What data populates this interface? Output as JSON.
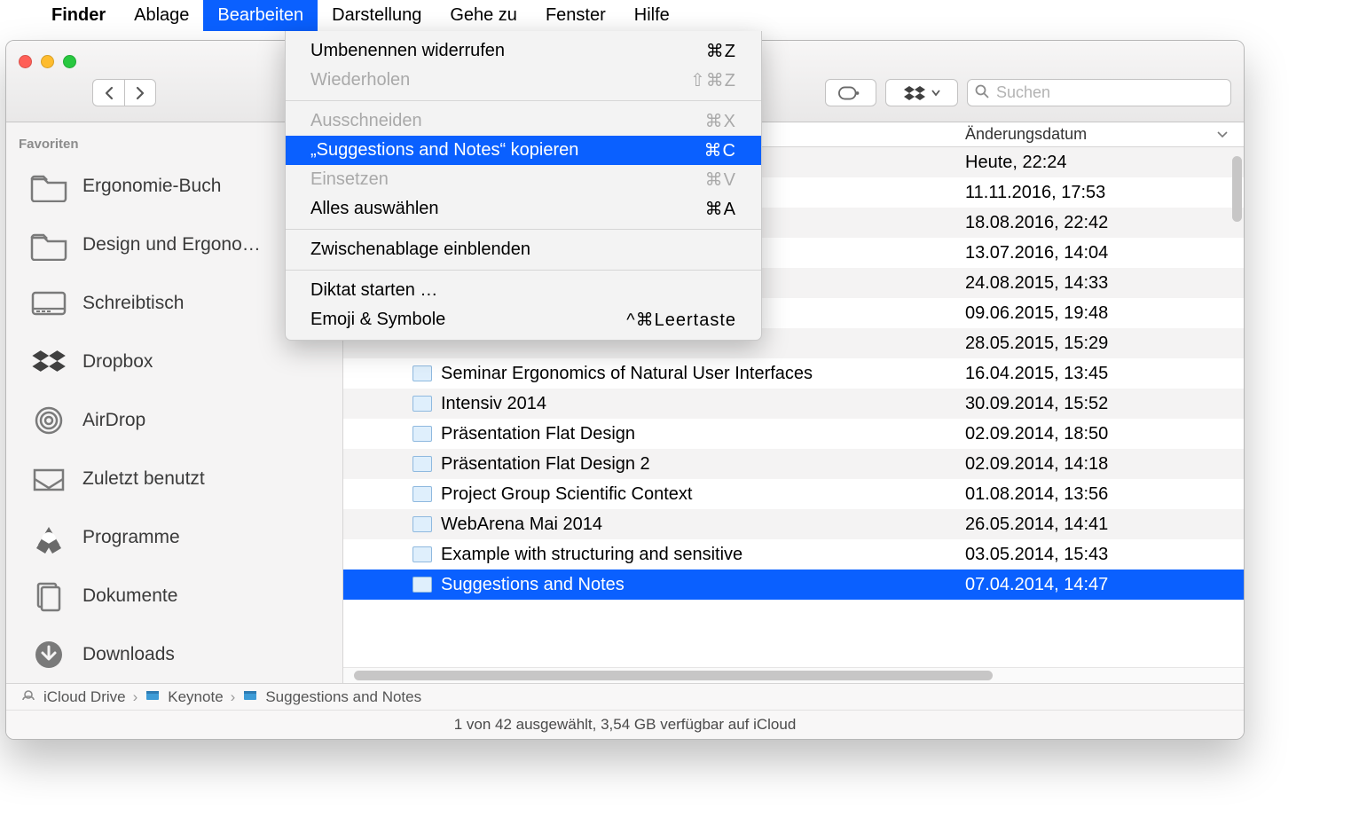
{
  "menubar": {
    "app": "Finder",
    "items": [
      "Ablage",
      "Bearbeiten",
      "Darstellung",
      "Gehe zu",
      "Fenster",
      "Hilfe"
    ],
    "active_index": 1
  },
  "dropdown": {
    "items": [
      {
        "label": "Umbenennen widerrufen",
        "shortcut": "⌘Z",
        "disabled": false
      },
      {
        "label": "Wiederholen",
        "shortcut": "⇧⌘Z",
        "disabled": true
      },
      {
        "sep": true
      },
      {
        "label": "Ausschneiden",
        "shortcut": "⌘X",
        "disabled": true
      },
      {
        "label": "„Suggestions and Notes“ kopieren",
        "shortcut": "⌘C",
        "hl": true
      },
      {
        "label": "Einsetzen",
        "shortcut": "⌘V",
        "disabled": true
      },
      {
        "label": "Alles auswählen",
        "shortcut": "⌘A"
      },
      {
        "sep": true
      },
      {
        "label": "Zwischenablage einblenden",
        "shortcut": ""
      },
      {
        "sep": true
      },
      {
        "label": "Diktat starten …",
        "shortcut": ""
      },
      {
        "label": "Emoji & Symbole",
        "shortcut": "^⌘Leertaste"
      }
    ]
  },
  "toolbar": {
    "search_placeholder": "Suchen"
  },
  "sidebar": {
    "header": "Favoriten",
    "items": [
      {
        "icon": "folder",
        "label": "Ergonomie-Buch"
      },
      {
        "icon": "folder",
        "label": "Design und Ergono…"
      },
      {
        "icon": "desktop",
        "label": "Schreibtisch"
      },
      {
        "icon": "dropbox",
        "label": "Dropbox"
      },
      {
        "icon": "airdrop",
        "label": "AirDrop"
      },
      {
        "icon": "recent",
        "label": "Zuletzt benutzt"
      },
      {
        "icon": "apps",
        "label": "Programme"
      },
      {
        "icon": "docs",
        "label": "Dokumente"
      },
      {
        "icon": "downloads",
        "label": "Downloads"
      }
    ]
  },
  "columns": {
    "name": "",
    "date": "Änderungsdatum"
  },
  "files": [
    {
      "name": "",
      "date": "Heute, 22:24"
    },
    {
      "name": "",
      "date": "11.11.2016, 17:53"
    },
    {
      "name": "",
      "date": "18.08.2016, 22:42"
    },
    {
      "name": "",
      "date": "13.07.2016, 14:04"
    },
    {
      "name": "",
      "date": "24.08.2015, 14:33"
    },
    {
      "name": "",
      "date": "09.06.2015, 19:48"
    },
    {
      "name": "",
      "date": "28.05.2015, 15:29"
    },
    {
      "name": "Seminar Ergonomics of Natural User Interfaces",
      "date": "16.04.2015, 13:45"
    },
    {
      "name": "Intensiv 2014",
      "date": "30.09.2014, 15:52"
    },
    {
      "name": "Präsentation Flat Design",
      "date": "02.09.2014, 18:50"
    },
    {
      "name": "Präsentation Flat Design 2",
      "date": "02.09.2014, 14:18"
    },
    {
      "name": "Project Group Scientific Context",
      "date": "01.08.2014, 13:56"
    },
    {
      "name": "WebArena Mai 2014",
      "date": "26.05.2014, 14:41"
    },
    {
      "name": "Example with structuring and sensitive",
      "date": "03.05.2014, 15:43"
    },
    {
      "name": "Suggestions and Notes",
      "date": "07.04.2014, 14:47",
      "selected": true
    }
  ],
  "path": [
    "iCloud Drive",
    "Keynote",
    "Suggestions and Notes"
  ],
  "status": "1 von 42 ausgewählt, 3,54 GB verfügbar auf iCloud"
}
